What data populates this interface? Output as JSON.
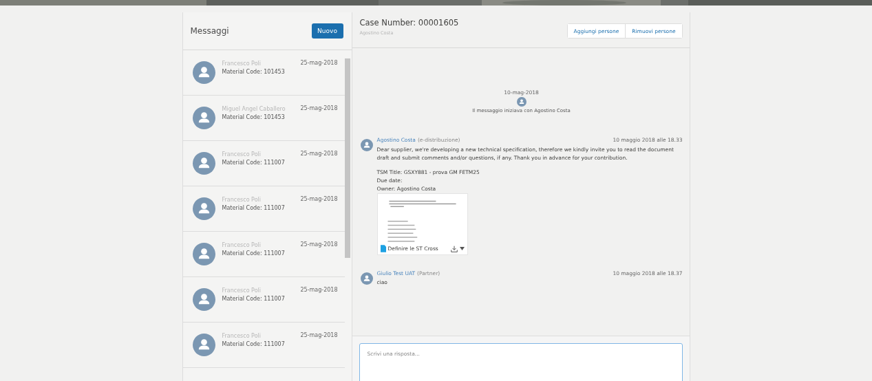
{
  "messages_panel": {
    "title": "Messaggi",
    "new_button": "Nuovo",
    "items": [
      {
        "name": "Francesco Poli",
        "subject": "Material Code: 101453",
        "date": "25-mag-2018"
      },
      {
        "name": "Miguel Angel Caballero",
        "subject": "Material Code: 101453",
        "date": "25-mag-2018"
      },
      {
        "name": "Francesco Poli",
        "subject": "Material Code: 111007",
        "date": "25-mag-2018"
      },
      {
        "name": "Francesco Poli",
        "subject": "Material Code: 111007",
        "date": "25-mag-2018"
      },
      {
        "name": "Francesco Poli",
        "subject": "Material Code: 111007",
        "date": "25-mag-2018"
      },
      {
        "name": "Francesco Poli",
        "subject": "Material Code: 111007",
        "date": "25-mag-2018"
      },
      {
        "name": "Francesco Poli",
        "subject": "Material Code: 111007",
        "date": "25-mag-2018"
      }
    ]
  },
  "conversation": {
    "title": "Case Number: 00001605",
    "subtitle": "Agostino Costa",
    "buttons": [
      "Aggiungi persone",
      "Rimuovi persone"
    ],
    "start": {
      "date": "10-mag-2018",
      "text": "Il messaggio iniziava con Agostino Costa"
    },
    "posts": [
      {
        "author": "Agostino Costa",
        "role": "(e-distribuzione)",
        "time": "10 maggio 2018 alle 18.33",
        "paragraphs": [
          "Dear supplier, we're developing a new technical specification, therefore we kindly invite you to read the document draft and submit comments and/or questions, if any. Thank you in advance for your contribution.",
          "TSM Title: GSXY881 - prova GM FETM25\nDue date:\nOwner: Agostino Costa"
        ],
        "attachment": {
          "name": "Definire le ST Cross"
        }
      },
      {
        "author": "Giulio Test UAT",
        "role": "(Partner)",
        "time": "10 maggio 2018 alle 18.37",
        "paragraphs": [
          "ciao"
        ]
      }
    ],
    "reply": {
      "placeholder": "Scrivi una risposta..."
    }
  }
}
